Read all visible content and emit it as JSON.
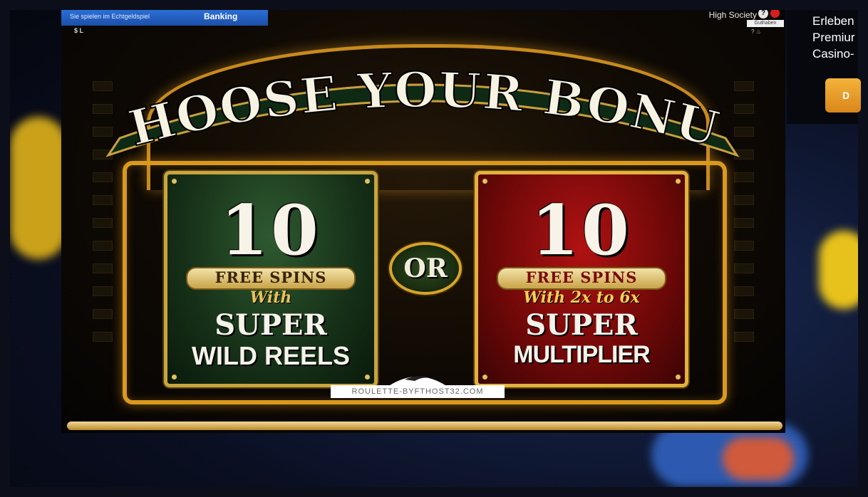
{
  "top_bar": {
    "real_money_text": "Sie spielen im Echtgeldspiel",
    "banking_label": "Banking",
    "coins_text": "$ L",
    "brand": "High Society",
    "help_label": "?",
    "balance_text": "Guthaben"
  },
  "banner": {
    "title": "CHOOSE YOUR BONUS"
  },
  "options": [
    {
      "number": "10",
      "free_spins": "FREE SPINS",
      "with": "With",
      "line1": "SUPER",
      "line2": "WILD REELS",
      "color": "#163018"
    },
    {
      "number": "10",
      "free_spins": "FREE SPINS",
      "with": "With 2x to 6x",
      "line1": "SUPER",
      "line2": "MULTIPLIER",
      "color": "#6e0808"
    }
  ],
  "or_label": "OR",
  "watermark": "ROULETTE-BYFTHOST32.COM",
  "side_ad": {
    "line1": "Erleben",
    "line2": "Premiur",
    "line3": "Casino-",
    "button": "D"
  },
  "colors": {
    "gold": "#d9991c",
    "green_card": "#163018",
    "red_card": "#6e0808"
  }
}
